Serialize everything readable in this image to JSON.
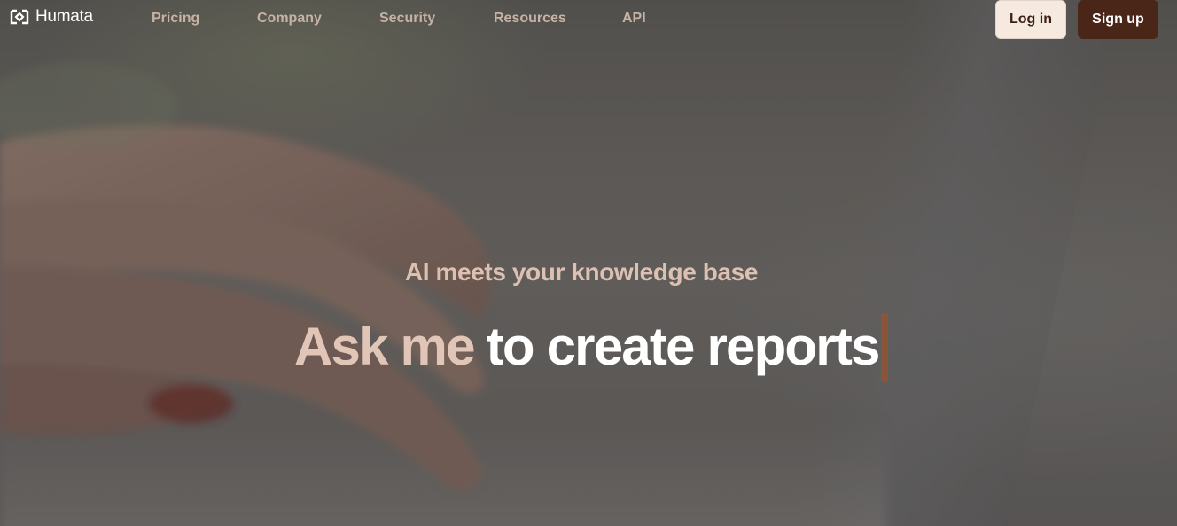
{
  "brand": {
    "name": "Humata",
    "logo_icon": "humata-logo-icon"
  },
  "nav": {
    "items": [
      {
        "label": "Pricing"
      },
      {
        "label": "Company"
      },
      {
        "label": "Security"
      },
      {
        "label": "Resources"
      },
      {
        "label": "API"
      }
    ],
    "login_label": "Log in",
    "signup_label": "Sign up"
  },
  "hero": {
    "eyebrow": "AI meets your knowledge base",
    "headline_lead": "Ask me",
    "headline_rest": "to create reports",
    "background_image": "hand-typing-on-laptop"
  },
  "colors": {
    "nav_link": "#c7b2a6",
    "login_bg": "#f6e9df",
    "signup_bg": "#4a2619",
    "eyebrow": "#dcc1b3",
    "headline_lead": "#e1c6b8",
    "cursor": "#8a5637"
  }
}
